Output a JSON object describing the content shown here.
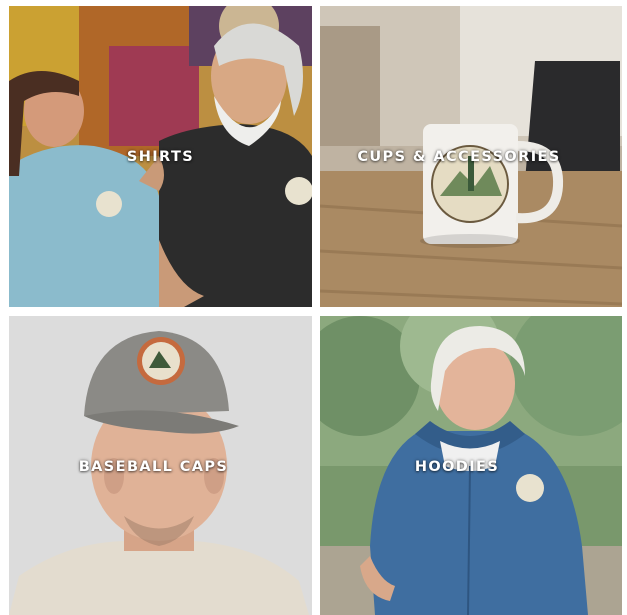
{
  "categories": [
    {
      "id": "shirts",
      "label": "SHIRTS",
      "image": "couple-wearing-shirts-photo"
    },
    {
      "id": "cups",
      "label": "CUPS & ACCESSORIES",
      "image": "mug-on-desk-photo"
    },
    {
      "id": "caps",
      "label": "BASEBALL CAPS",
      "image": "man-wearing-cap-photo"
    },
    {
      "id": "hoodies",
      "label": "HOODIES",
      "image": "woman-wearing-hoodie-photo"
    }
  ]
}
